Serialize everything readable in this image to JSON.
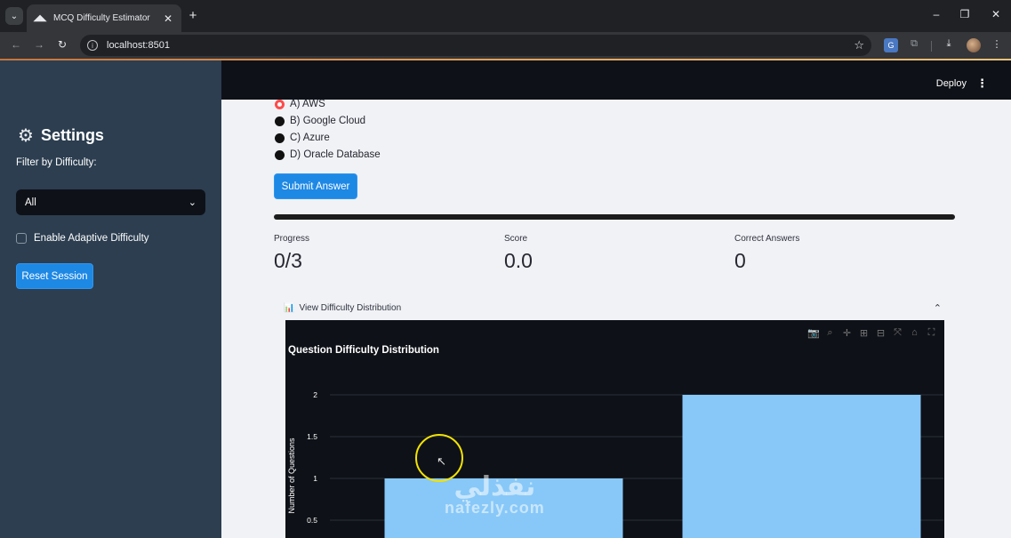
{
  "browser": {
    "tab_title": "MCQ Difficulty Estimator",
    "tab_close": "✕",
    "new_tab": "+",
    "url": "localhost:8501",
    "window": {
      "minimize": "–",
      "restore": "❐",
      "close": "✕"
    }
  },
  "app": {
    "topbar": {
      "deploy_label": "Deploy",
      "menu_icon": "⋮"
    },
    "sidebar": {
      "title": "Settings",
      "filter_label": "Filter by Difficulty:",
      "filter_value": "All",
      "adaptive_label": "Enable Adaptive Difficulty",
      "adaptive_checked": false,
      "reset_label": "Reset Session"
    },
    "question": {
      "options": [
        {
          "label": "A) AWS",
          "selected": true
        },
        {
          "label": "B) Google Cloud",
          "selected": false
        },
        {
          "label": "C) Azure",
          "selected": false
        },
        {
          "label": "D) Oracle Database",
          "selected": false
        }
      ],
      "submit_label": "Submit Answer"
    },
    "progress_fraction": 0.0,
    "metrics": [
      {
        "label": "Progress",
        "value": "0/3"
      },
      {
        "label": "Score",
        "value": "0.0"
      },
      {
        "label": "Correct Answers",
        "value": "0"
      }
    ],
    "expander": {
      "label": "View Difficulty Distribution",
      "icon": "📊",
      "expanded": true
    }
  },
  "chart_data": {
    "type": "bar",
    "title": "Question Difficulty Distribution",
    "xlabel": "",
    "ylabel": "Number of Questions",
    "categories": [
      "",
      ""
    ],
    "values": [
      1,
      2
    ],
    "ylim": [
      0,
      2.2
    ],
    "yticks": [
      "0.5",
      "1",
      "1.5",
      "2"
    ],
    "bar_color": "#87c8f8",
    "grid": true,
    "colors": {
      "background": "#0e1117",
      "grid": "#2b2f3a",
      "text": "#ffffff"
    }
  },
  "overlay": {
    "watermark_ar": "نفذلي",
    "watermark_en": "nafezly.com"
  }
}
